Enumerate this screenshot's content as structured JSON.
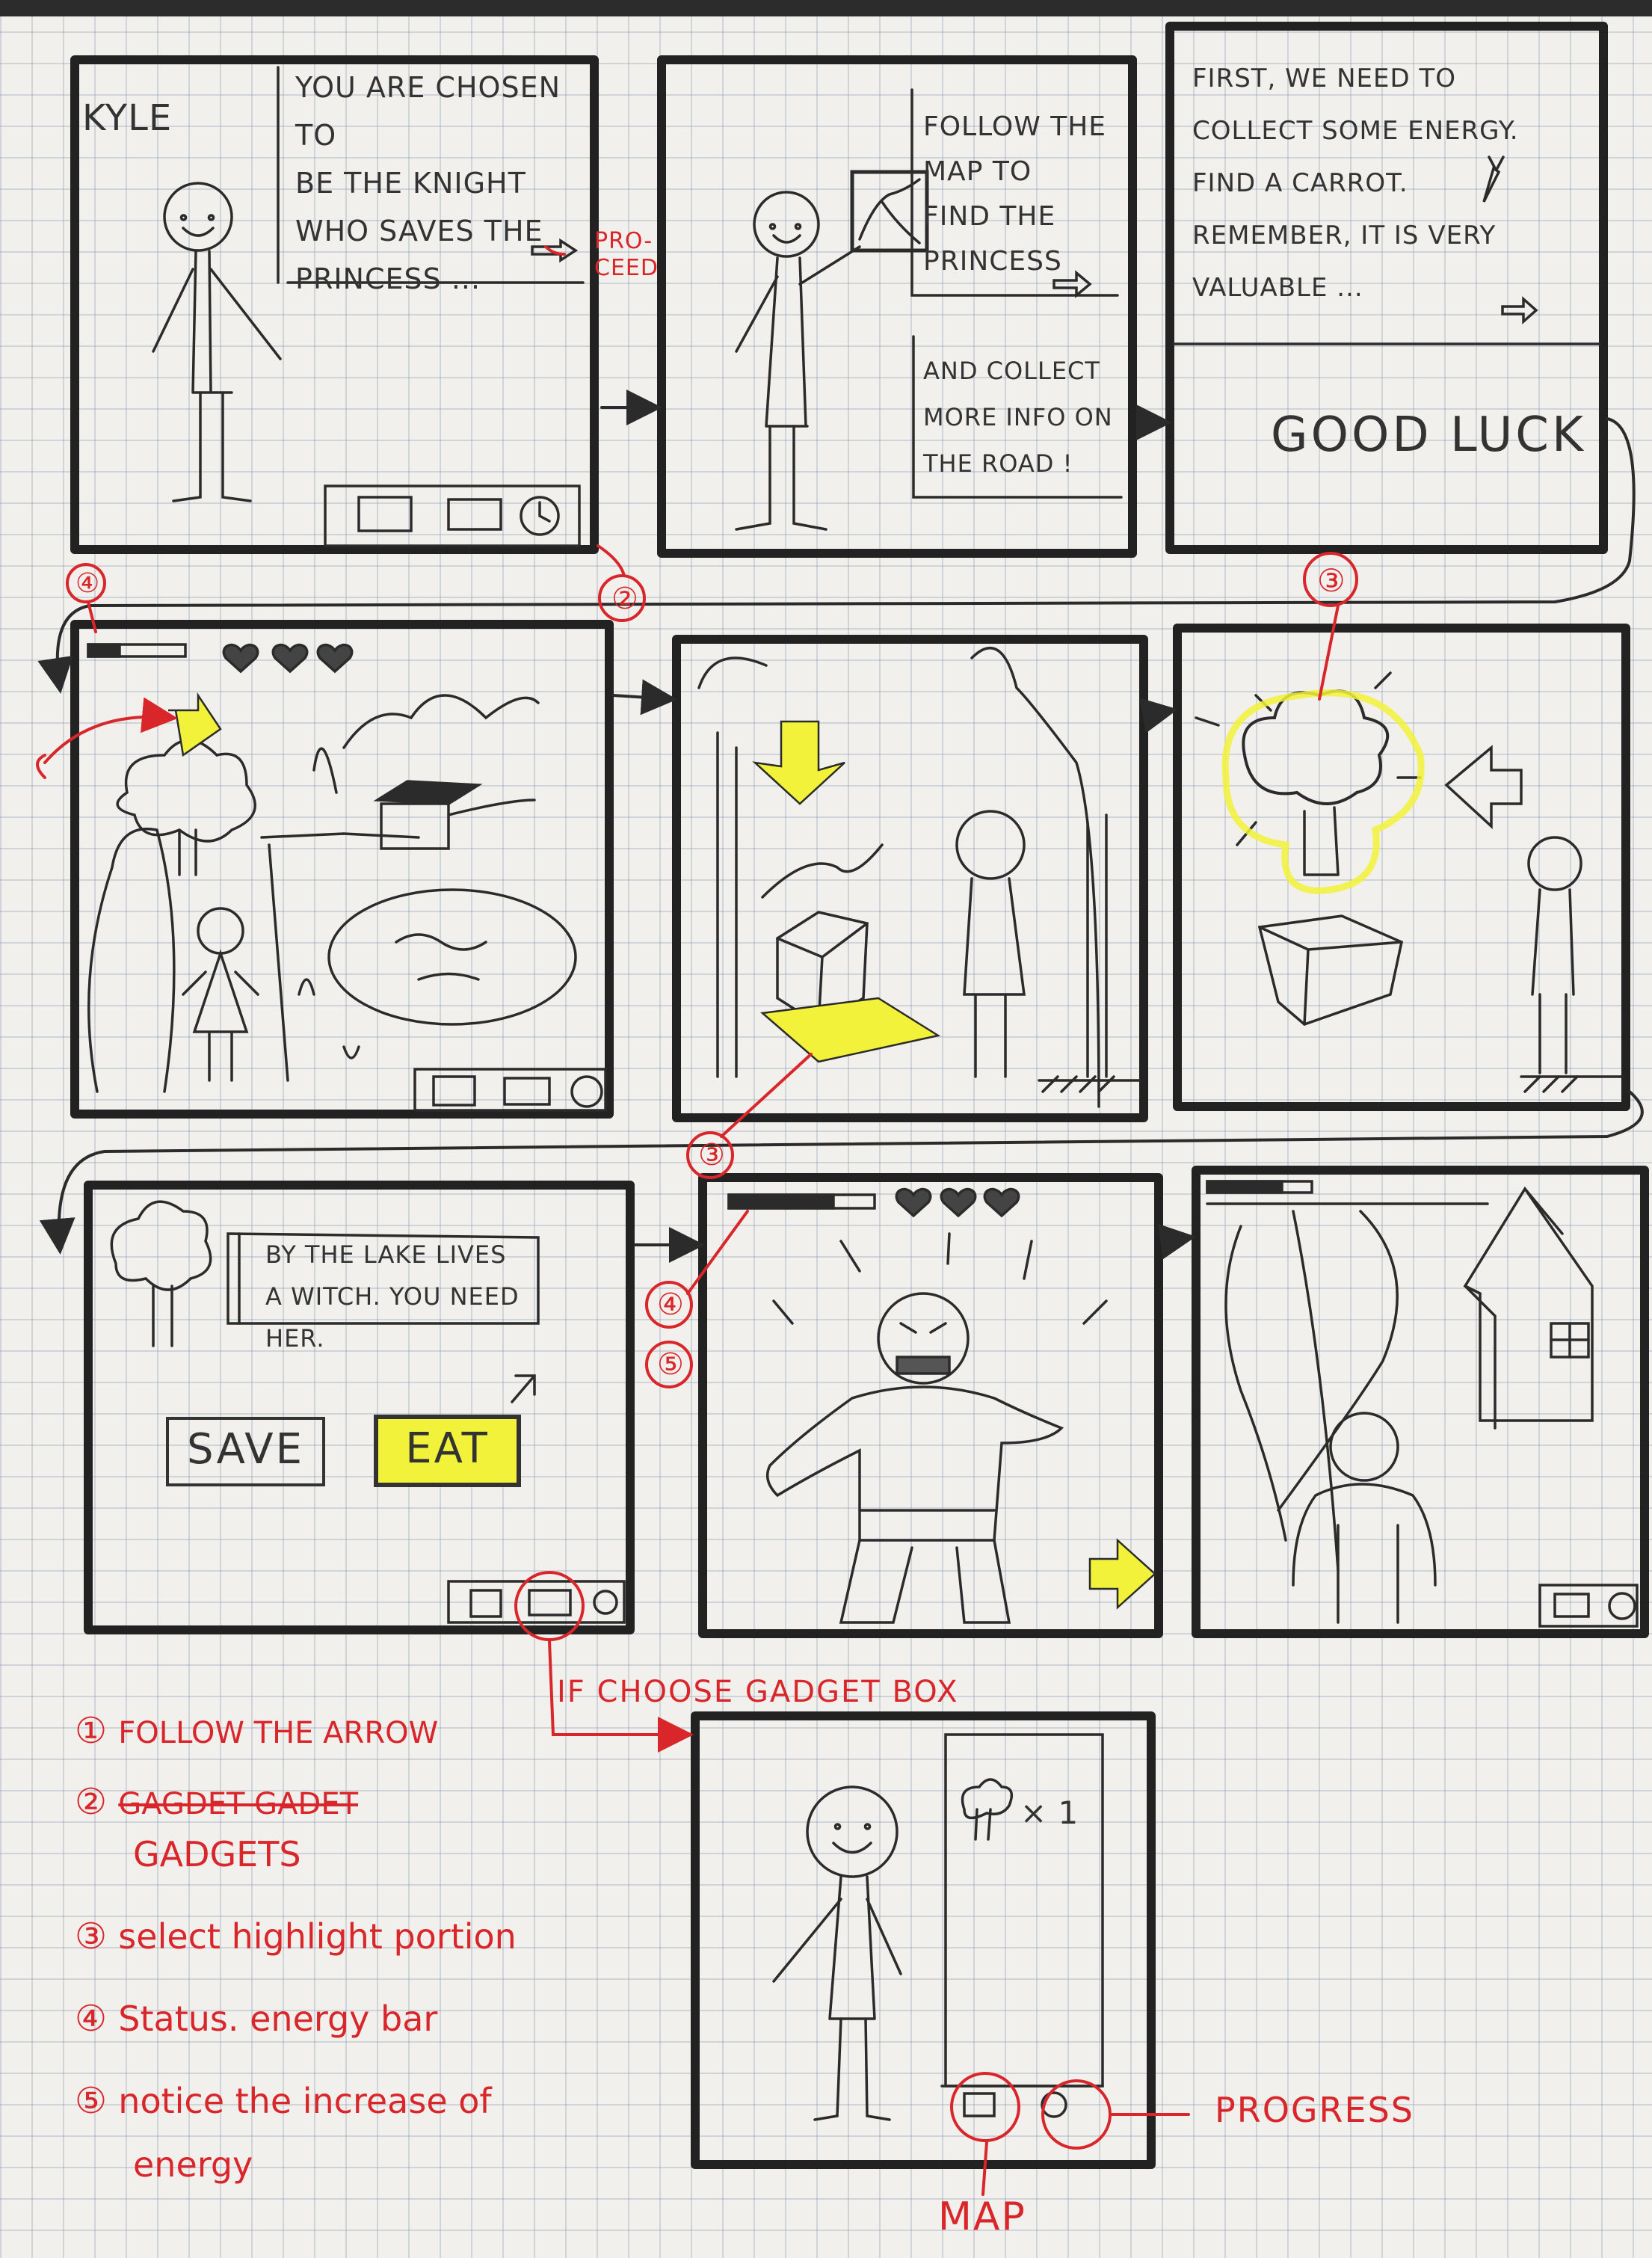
{
  "panels": {
    "p1": {
      "name": "KYLE",
      "dialog": [
        "YOU ARE CHOSEN TO",
        "BE THE KNIGHT",
        "WHO SAVES THE",
        "PRINCESS ..."
      ],
      "note": "pro-ceed"
    },
    "p2": {
      "dialog1": [
        "FOLLOW THE",
        "MAP TO",
        "FIND THE",
        "PRINCESS"
      ],
      "dialog2": [
        "AND COLLECT",
        "MORE INFO ON",
        "THE ROAD !"
      ]
    },
    "p3": {
      "dialog": [
        "FIRST, WE NEED TO",
        "COLLECT SOME ENERGY.",
        "FIND A CARROT.",
        "REMEMBER, IT IS VERY",
        "VALUABLE ..."
      ],
      "footer": "GOOD LUCK"
    },
    "p7": {
      "dialog": [
        "BY THE LAKE LIVES",
        "A WITCH. YOU NEED HER."
      ],
      "save_label": "SAVE",
      "eat_label": "EAT"
    },
    "p10": {
      "inventory_item": "× 1"
    }
  },
  "annotations": {
    "circle2": "②",
    "circle3a": "③",
    "circle4a": "④",
    "circle3b": "③",
    "circle4b": "④",
    "circle5": "⑤",
    "if_choose": "IF CHOOSE  GADGET BOX",
    "progress": "PROGRESS",
    "map": "MAP"
  },
  "legend": [
    {
      "num": "①",
      "text": "FOLLOW THE ARROW"
    },
    {
      "num": "②",
      "text": "GAGDET GADET",
      "sub": "GADGETS"
    },
    {
      "num": "③",
      "text": "select highlight portion"
    },
    {
      "num": "④",
      "text": "Status. energy bar"
    },
    {
      "num": "⑤",
      "text": "notice the increase of",
      "sub": "energy"
    }
  ],
  "colors": {
    "ink": "#2b2b2b",
    "pen_red": "#d9262a",
    "highlight": "#f2f23a",
    "paper": "#f1f0ec",
    "grid": "#a9b6c8"
  },
  "icons": [
    "map-icon",
    "gadget-box-icon",
    "clock-icon",
    "heart-icon",
    "arrow-down-icon",
    "arrow-right-icon",
    "arrow-left-icon"
  ]
}
